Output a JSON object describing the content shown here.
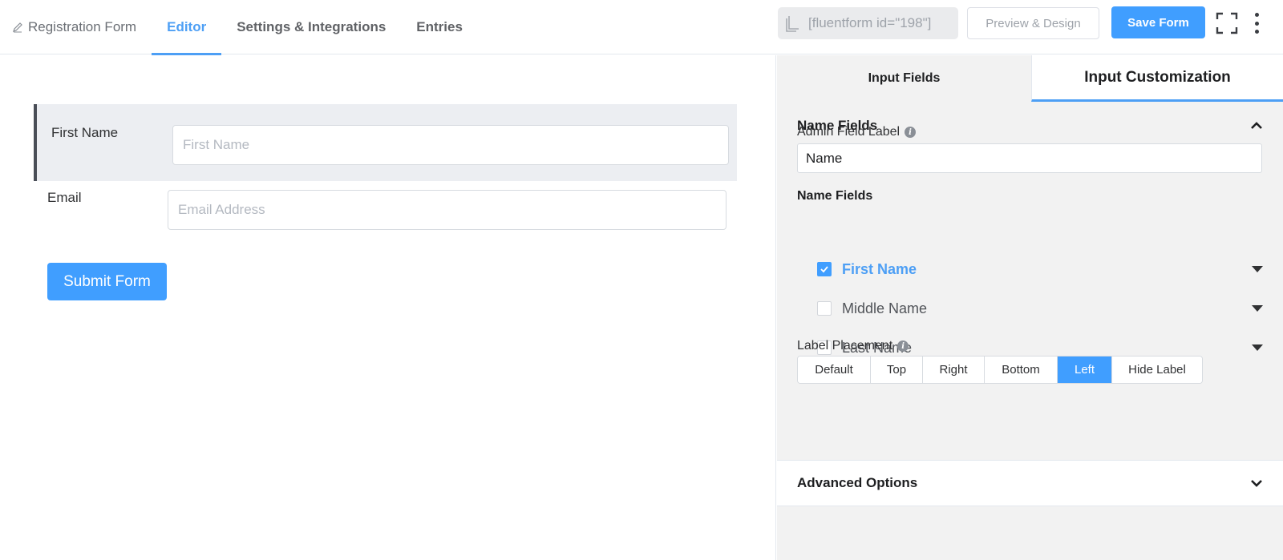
{
  "nav": {
    "form_title": "Registration Form",
    "tabs": [
      "Editor",
      "Settings & Integrations",
      "Entries"
    ],
    "active_tab": "Editor"
  },
  "toolbar": {
    "shortcode": "[fluentform id=\"198\"]",
    "preview_label": "Preview & Design",
    "save_label": "Save Form"
  },
  "form": {
    "first_name_label": "First Name",
    "first_name_placeholder": "First Name",
    "email_label": "Email",
    "email_placeholder": "Email Address",
    "submit_label": "Submit Form"
  },
  "panel": {
    "tabs": [
      "Input Fields",
      "Input Customization"
    ],
    "active_tab": "Input Customization",
    "section_title": "Name Fields",
    "admin_label_title": "Admin Field Label",
    "admin_label_value": "Name",
    "name_fields_title": "Name Fields",
    "name_fields": [
      {
        "label": "First Name",
        "checked": true
      },
      {
        "label": "Middle Name",
        "checked": false
      },
      {
        "label": "Last Name",
        "checked": false
      }
    ],
    "placement_title": "Label Placement",
    "placement_options": [
      "Default",
      "Top",
      "Right",
      "Bottom",
      "Left",
      "Hide Label"
    ],
    "placement_selected": "Left",
    "advanced_title": "Advanced Options"
  },
  "colors": {
    "accent": "#409eff",
    "active_tab": "#4d9ff5",
    "panel_bg": "#f2f2f2"
  }
}
